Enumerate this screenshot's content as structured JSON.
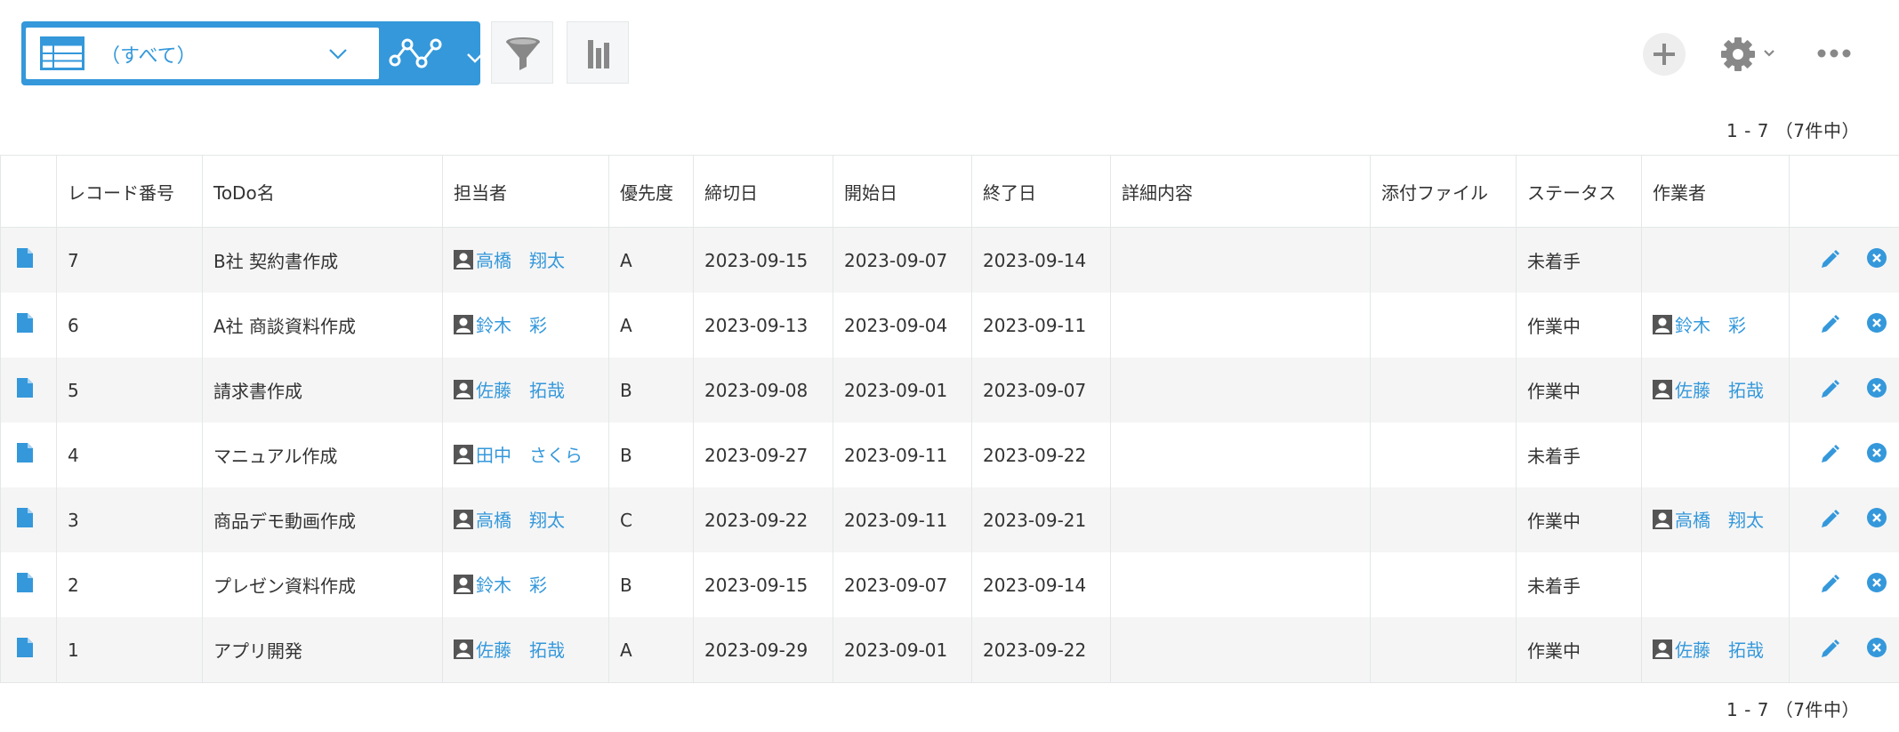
{
  "toolbar": {
    "view_select_label": "（すべて）",
    "icons": {
      "table": "table-view-icon",
      "graph": "graph-icon",
      "filter": "filter-icon",
      "chart": "bar-chart-icon",
      "add": "plus-icon",
      "settings": "gear-icon",
      "more": "more-icon"
    }
  },
  "pagination": {
    "top": "1 - 7 （7件中）",
    "bottom": "1 - 7 （7件中）"
  },
  "table": {
    "headers": [
      "レコード番号",
      "ToDo名",
      "担当者",
      "優先度",
      "締切日",
      "開始日",
      "終了日",
      "詳細内容",
      "添付ファイル",
      "ステータス",
      "作業者"
    ],
    "rows": [
      {
        "record_no": "7",
        "todo": "B社 契約書作成",
        "assignee": "高橋　翔太",
        "priority": "A",
        "deadline": "2023-09-15",
        "start": "2023-09-07",
        "end": "2023-09-14",
        "detail": "",
        "attachment": "",
        "status": "未着手",
        "worker": ""
      },
      {
        "record_no": "6",
        "todo": "A社 商談資料作成",
        "assignee": "鈴木　彩",
        "priority": "A",
        "deadline": "2023-09-13",
        "start": "2023-09-04",
        "end": "2023-09-11",
        "detail": "",
        "attachment": "",
        "status": "作業中",
        "worker": "鈴木　彩"
      },
      {
        "record_no": "5",
        "todo": "請求書作成",
        "assignee": "佐藤　拓哉",
        "priority": "B",
        "deadline": "2023-09-08",
        "start": "2023-09-01",
        "end": "2023-09-07",
        "detail": "",
        "attachment": "",
        "status": "作業中",
        "worker": "佐藤　拓哉"
      },
      {
        "record_no": "4",
        "todo": "マニュアル作成",
        "assignee": "田中　さくら",
        "priority": "B",
        "deadline": "2023-09-27",
        "start": "2023-09-11",
        "end": "2023-09-22",
        "detail": "",
        "attachment": "",
        "status": "未着手",
        "worker": ""
      },
      {
        "record_no": "3",
        "todo": "商品デモ動画作成",
        "assignee": "高橋　翔太",
        "priority": "C",
        "deadline": "2023-09-22",
        "start": "2023-09-11",
        "end": "2023-09-21",
        "detail": "",
        "attachment": "",
        "status": "作業中",
        "worker": "高橋　翔太"
      },
      {
        "record_no": "2",
        "todo": "プレゼン資料作成",
        "assignee": "鈴木　彩",
        "priority": "B",
        "deadline": "2023-09-15",
        "start": "2023-09-07",
        "end": "2023-09-14",
        "detail": "",
        "attachment": "",
        "status": "未着手",
        "worker": ""
      },
      {
        "record_no": "1",
        "todo": "アプリ開発",
        "assignee": "佐藤　拓哉",
        "priority": "A",
        "deadline": "2023-09-29",
        "start": "2023-09-01",
        "end": "2023-09-22",
        "detail": "",
        "attachment": "",
        "status": "作業中",
        "worker": "佐藤　拓哉"
      }
    ]
  },
  "colors": {
    "accent": "#3498db",
    "row_alt": "#f5f5f5",
    "border": "#e3e7e8",
    "icon_gray": "#888888"
  }
}
